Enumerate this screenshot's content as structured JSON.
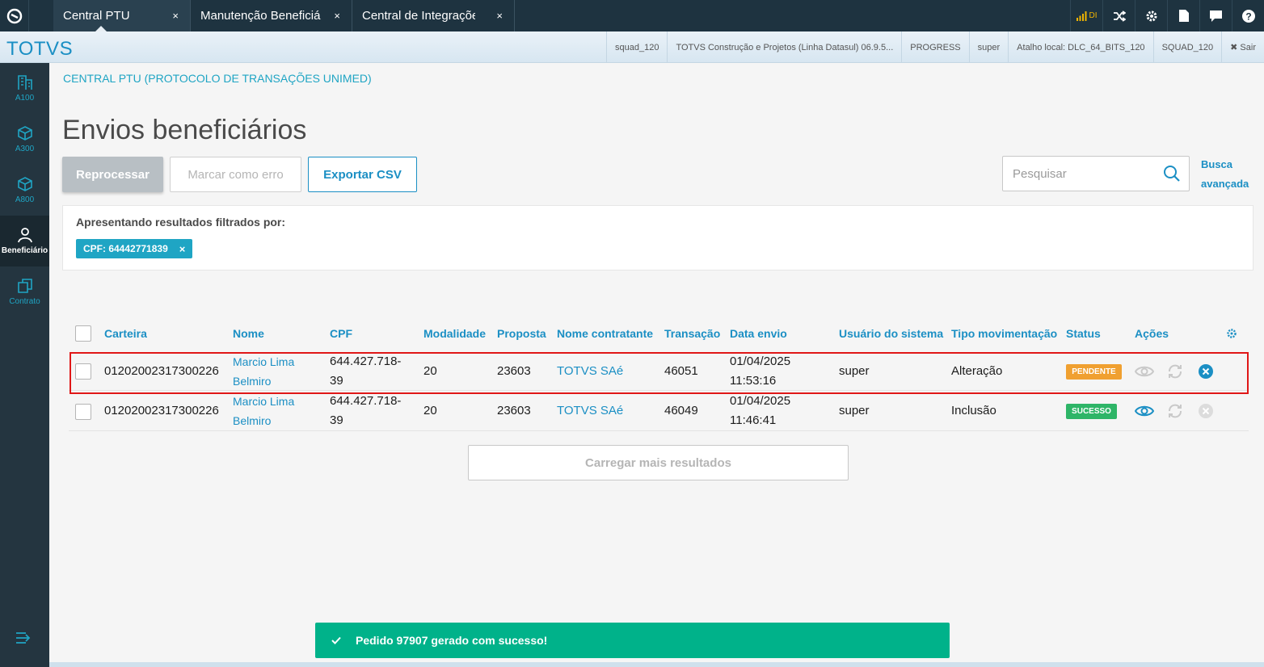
{
  "tabs": [
    {
      "label": "Central PTU",
      "close": "×",
      "active": true
    },
    {
      "label": "Manutenção Beneficiá",
      "close": "×",
      "active": false
    },
    {
      "label": "Central de Integrações",
      "close": "×",
      "active": false
    }
  ],
  "topbar": {
    "signal_text": "DI"
  },
  "header": {
    "brand": "TOTVS",
    "info": [
      "squad_120",
      "TOTVS Construção e Projetos (Linha Datasul) 06.9.5...",
      "PROGRESS",
      "super",
      "Atalho local: DLC_64_BITS_120",
      "SQUAD_120"
    ],
    "sair": "✖ Sair"
  },
  "sidebar": {
    "items": [
      {
        "label": "A100",
        "icon": "building-icon"
      },
      {
        "label": "A300",
        "icon": "cube-icon"
      },
      {
        "label": "A800",
        "icon": "cube-icon"
      },
      {
        "label": "Beneficiário",
        "icon": "user-icon",
        "active": true
      },
      {
        "label": "Contrato",
        "icon": "copy-icon"
      }
    ]
  },
  "breadcrumb": "CENTRAL PTU (PROTOCOLO DE TRANSAÇÕES UNIMED)",
  "page_title": "Envios beneficiários",
  "buttons": {
    "reprocessar": "Reprocessar",
    "marcar_erro": "Marcar como erro",
    "exportar": "Exportar CSV"
  },
  "search": {
    "placeholder": "Pesquisar",
    "advanced_line1": "Busca",
    "advanced_line2": "avançada"
  },
  "filters": {
    "label": "Apresentando resultados filtrados por:",
    "chip": "CPF: 64442771839",
    "chip_close": "×"
  },
  "table": {
    "headers": [
      "Carteira",
      "Nome",
      "CPF",
      "Modalidade",
      "Proposta",
      "Nome contratante",
      "Transação",
      "Data envio",
      "Usuário do sistema",
      "Tipo movimentação",
      "Status",
      "Ações"
    ],
    "rows": [
      {
        "carteira": "01202002317300226",
        "nome1": "Marcio Lima",
        "nome2": "Belmiro",
        "cpf1": "644.427.718-",
        "cpf2": "39",
        "modalidade": "20",
        "proposta": "23603",
        "contratante": "TOTVS SAé",
        "transacao": "46051",
        "data1": "01/04/2025",
        "data2": "11:53:16",
        "usuario": "super",
        "tipo": "Alteração",
        "status": "PENDENTE"
      },
      {
        "carteira": "01202002317300226",
        "nome1": "Marcio Lima",
        "nome2": "Belmiro",
        "cpf1": "644.427.718-",
        "cpf2": "39",
        "modalidade": "20",
        "proposta": "23603",
        "contratante": "TOTVS SAé",
        "transacao": "46049",
        "data1": "01/04/2025",
        "data2": "11:46:41",
        "usuario": "super",
        "tipo": "Inclusão",
        "status": "SUCESSO"
      }
    ]
  },
  "load_more": "Carregar mais resultados",
  "toast": "Pedido 97907 gerado com sucesso!",
  "colors": {
    "accent": "#1b8fc4",
    "teal": "#1fa5c4",
    "pending": "#f0a030",
    "success": "#2eb567",
    "toast": "#00b28a",
    "highlight": "#e01717"
  }
}
